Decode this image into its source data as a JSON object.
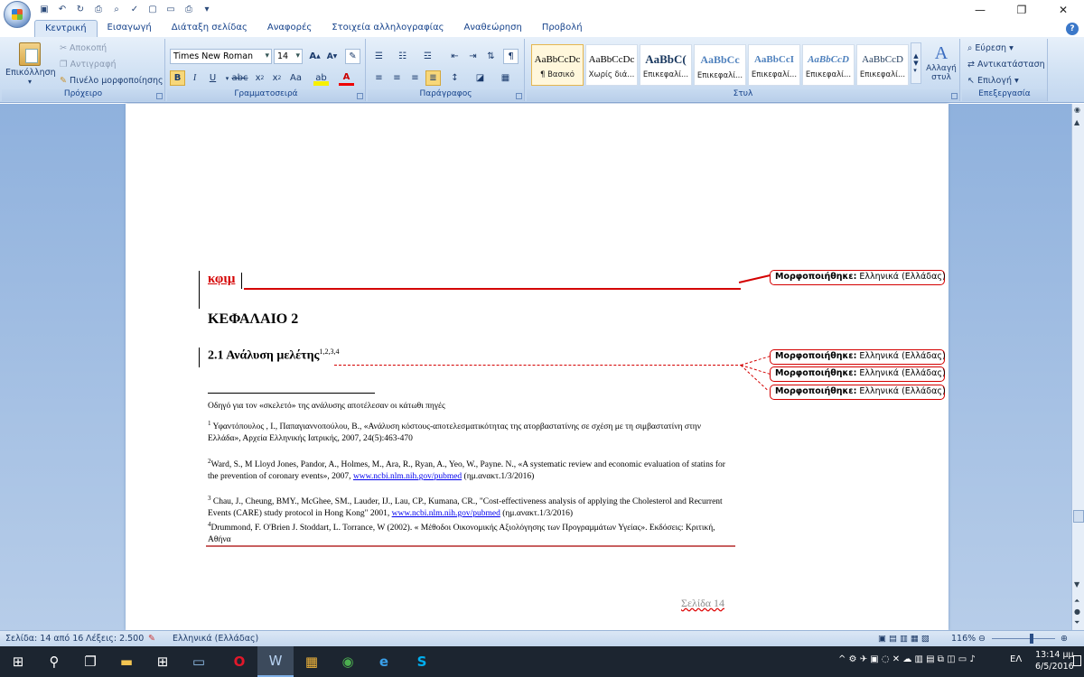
{
  "tabs": [
    "Κεντρική",
    "Εισαγωγή",
    "Διάταξη σελίδας",
    "Αναφορές",
    "Στοιχεία αλληλογραφίας",
    "Αναθεώρηση",
    "Προβολή"
  ],
  "clipboard": {
    "paste": "Επικόλληση",
    "cut": "Αποκοπή",
    "copy": "Αντιγραφή",
    "painter": "Πινέλο μορφοποίησης",
    "label": "Πρόχειρο"
  },
  "font": {
    "name": "Times New Roman",
    "size": "14",
    "label": "Γραμματοσειρά"
  },
  "paragraph": {
    "label": "Παράγραφος"
  },
  "styles": {
    "label": "Στυλ",
    "items": [
      {
        "preview": "AaBbCcDc",
        "name": "¶ Βασικό"
      },
      {
        "preview": "AaBbCcDc",
        "name": "Χωρίς διά..."
      },
      {
        "preview": "AaBbC(",
        "name": "Επικεφαλί..."
      },
      {
        "preview": "AaBbCc",
        "name": "Επικεφαλί..."
      },
      {
        "preview": "AaBbCcI",
        "name": "Επικεφαλί..."
      },
      {
        "preview": "AaBbCcD",
        "name": "Επικεφαλί..."
      },
      {
        "preview": "AaBbCcD",
        "name": "Επικεφαλί..."
      }
    ],
    "change": "Αλλαγή στυλ"
  },
  "editing": {
    "find": "Εύρεση",
    "replace": "Αντικατάσταση",
    "select": "Επιλογή",
    "label": "Επεξεργασία"
  },
  "doc": {
    "heading_red": "κφιμ",
    "chapter": "ΚΕΦΑΛΑΙΟ 2",
    "section": "2.1 Ανάλυση μελέτης",
    "section_refs": "1,2,3,4",
    "intro": "Οδηγό για τον «σκελετό» της ανάλυσης αποτέλεσαν οι κάτωθι πηγές",
    "fn1": "Υφαντόπουλος , Ι., Παπαγιαννοπούλου, Β., «Ανάλυση κόστους-αποτελεσματικότητας της ατορβαστατίνης σε σχέση με τη σιμβαστατίνη στην Ελλάδα», Αρχεία Ελληνικής Ιατρικής, 2007, 24(5):463-470",
    "fn2": "Ward, S., M Lloyd Jones, Pandor, A., Holmes, M., Ara, R., Ryan, A., Yeo, W., Payne. N., «A systematic review and economic evaluation of statins for the prevention of coronary events», 2007,",
    "fn2_link": "www.ncbi.nlm.nih.gov/pubmed",
    "fn2_tail": "(ημ.ανακτ.1/3/2016)",
    "fn3": "Chau, J., Cheung, BMY., McGhee, SM., Lauder, IJ., Lau, CP., Kumana, CR., \"Cost-effectiveness analysis of applying the Cholesterol and Recurrent Events (CARE) study protocol in Hong Kong\" 2001,",
    "fn3_link": "www.ncbi.nlm.nih.gov/pubmed",
    "fn3_tail": "(ημ.ανακτ.1/3/2016)",
    "fn4": "Drummond, F. O'Brien J. Stoddart, L. Torrance, W (2002). « Μέθοδοι Οικονομικής Αξιολόγησης των Προγραμμάτων Υγείας». Εκδόσεις: Κριτική, Αθήνα",
    "page_num": "Σελίδα 14"
  },
  "balloons": {
    "label": "Μορφοποιήθηκε:",
    "value": "Ελληνικά (Ελλάδας)"
  },
  "status": {
    "page": "Σελίδα: 14 από 16",
    "words": "Λέξεις: 2.500",
    "lang": "Ελληνικά (Ελλάδας)",
    "zoom": "116%"
  },
  "tray": {
    "lang": "ΕΛ",
    "time": "13:14 μμ",
    "date": "6/5/2016"
  }
}
